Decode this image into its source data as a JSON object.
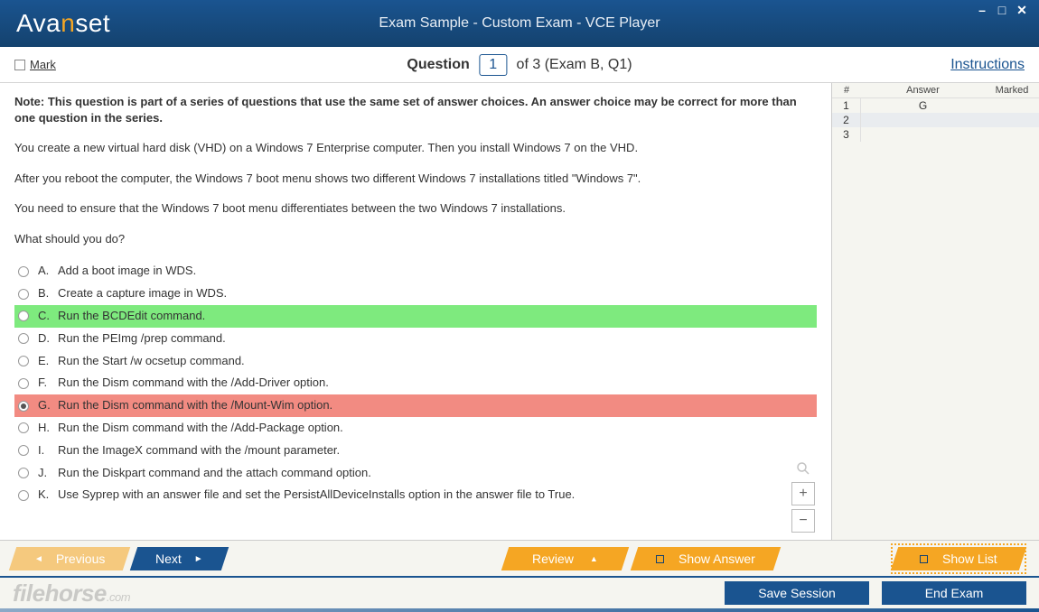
{
  "titlebar": {
    "logo_pre": "Ava",
    "logo_n": "n",
    "logo_post": "set",
    "title": "Exam Sample - Custom Exam - VCE Player"
  },
  "qbar": {
    "mark": "Mark",
    "qword": "Question",
    "qnum": "1",
    "tail": "of 3 (Exam B, Q1)",
    "instructions": "Instructions"
  },
  "question": {
    "note": "Note: This question is part of a series of questions that use the same set of answer choices. An answer choice may be correct for more than one question in the series.",
    "p1": "You create a new virtual hard disk (VHD) on a Windows 7 Enterprise computer. Then you install Windows 7 on the VHD.",
    "p2": "After you reboot the computer, the Windows 7 boot menu shows two different Windows 7 installations titled \"Windows 7\".",
    "p3": "You need to ensure that the Windows 7 boot menu differentiates between the two Windows 7 installations.",
    "p4": "What should you do?",
    "options": {
      "A": "Add a boot image in WDS.",
      "B": "Create a capture image in WDS.",
      "C": "Run the BCDEdit command.",
      "D": "Run the PEImg /prep command.",
      "E": "Run the Start /w ocsetup command.",
      "F": "Run the Dism command with the /Add-Driver option.",
      "G": "Run the Dism command with the /Mount-Wim option.",
      "H": "Run the Dism command with the /Add-Package option.",
      "I": "Run the ImageX command with the /mount parameter.",
      "J": "Run the Diskpart command and the attach command option.",
      "K": "Use Syprep with an answer file and set the PersistAllDeviceInstalls option in the answer file to True."
    }
  },
  "side": {
    "head_num": "#",
    "head_ans": "Answer",
    "head_mark": "Marked",
    "rows": [
      {
        "n": "1",
        "a": "G"
      },
      {
        "n": "2",
        "a": ""
      },
      {
        "n": "3",
        "a": ""
      }
    ]
  },
  "nav": {
    "previous": "Previous",
    "next": "Next",
    "review": "Review",
    "show_answer": "Show Answer",
    "show_list": "Show List",
    "save": "Save Session",
    "end": "End Exam"
  },
  "watermark": {
    "main": "filehorse",
    "ext": ".com"
  }
}
